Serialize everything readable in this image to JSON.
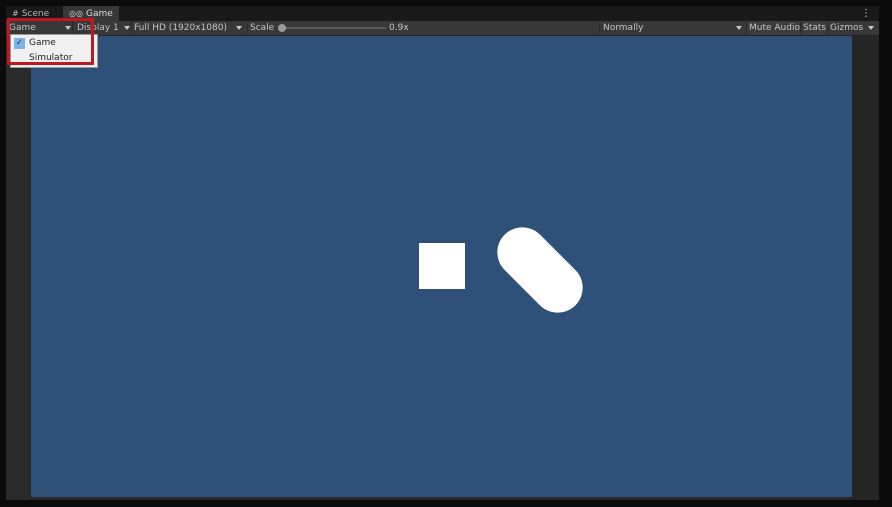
{
  "tabs": [
    {
      "label": "Scene",
      "icon": "grid-icon"
    },
    {
      "label": "Game",
      "icon": "gamepad-icon"
    }
  ],
  "toolbar": {
    "view_select": "Game",
    "display": "Display 1",
    "resolution": "Full HD (1920x1080)",
    "scale_label": "Scale",
    "scale_value": "0.9x",
    "play_mode": "Normally",
    "mute_audio": "Mute Audio",
    "stats": "Stats",
    "gizmos": "Gizmos"
  },
  "dropdown": {
    "items": [
      {
        "label": "Game",
        "checked": true
      },
      {
        "label": "Simulator",
        "checked": false
      }
    ]
  },
  "colors": {
    "viewport_background": "#2f5079",
    "highlight": "#c01820",
    "objects": "#ffffff"
  }
}
